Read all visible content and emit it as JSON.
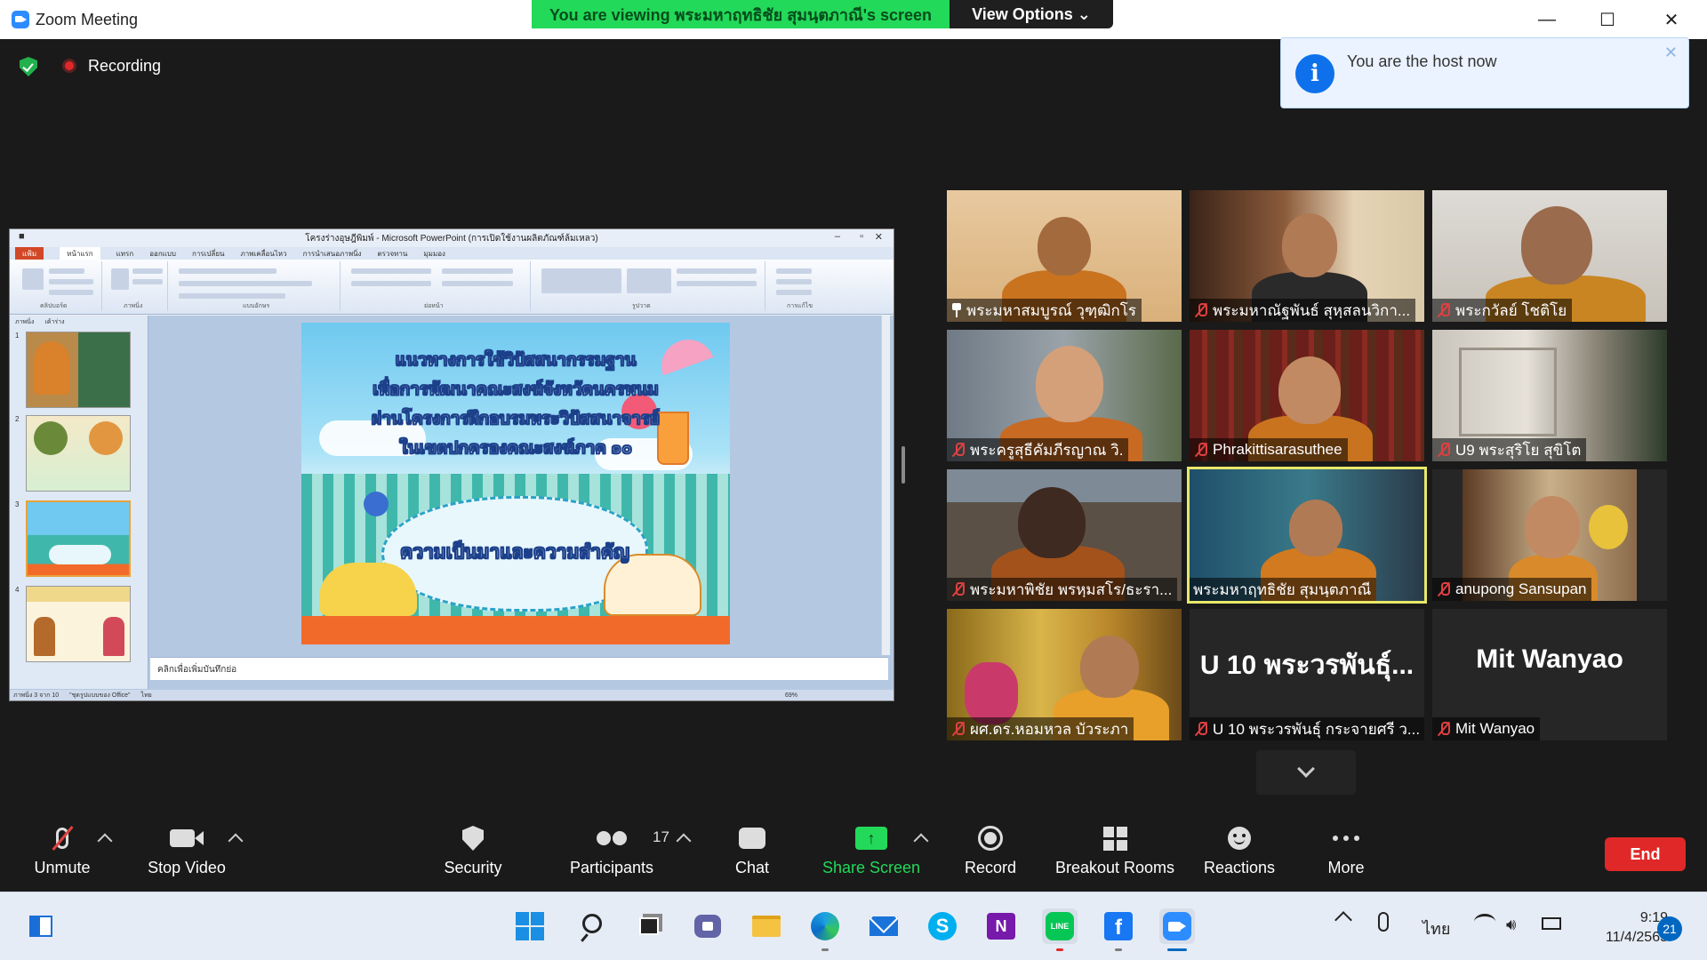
{
  "window": {
    "title": "Zoom Meeting",
    "minimize": "—",
    "maximize": "☐",
    "close": "✕"
  },
  "banner": {
    "viewing_text": "You are viewing พระมหาฤทธิชัย สุมนฺตภาณี's screen",
    "view_options": "View Options ⌄"
  },
  "status": {
    "recording": "Recording"
  },
  "toast": {
    "message": "You are the host now",
    "close": "✕"
  },
  "shared_screen": {
    "ppt_title": "โครงร่างอุษฎีพิมพ์ - Microsoft PowerPoint (การเปิดใช้งานผลิตภัณฑ์ล้มเหลว)",
    "ribbon_tabs": [
      "แฟ้ม",
      "หน้าแรก",
      "แทรก",
      "ออกแบบ",
      "การเปลี่ยน",
      "ภาพเคลื่อนไหว",
      "การนำเสนอภาพนิ่ง",
      "ตรวจทาน",
      "มุมมอง"
    ],
    "ribbon_groups": [
      "คลิปบอร์ด",
      "ภาพนิ่ง",
      "แบบอักษร",
      "ย่อหน้า",
      "รูปวาด",
      "การแก้ไข"
    ],
    "panel_tabs": [
      "ภาพนิ่ง",
      "เค้าร่าง"
    ],
    "slide_numbers": [
      "1",
      "2",
      "3",
      "4"
    ],
    "slide_title_lines": [
      "แนวทางการใช้วิปัสสนากรรมฐาน",
      "เพื่อการพัฒนาคณะสงฆ์จังหวัดนครพนม",
      "ผ่านโครงการฝึกอบรมพระวิปัสสนาจารย์",
      "ในเขตปกครองคณะสงฆ์ภาค ๑๐"
    ],
    "slide_subtitle": "ความเป็นมาและความสำคัญ",
    "notes_placeholder": "คลิกเพื่อเพิ่มบันทึกย่อ",
    "status_slide": "ภาพนิ่ง 3 จาก 10",
    "status_theme": "\"ชุดรูปแบบของ Office\"",
    "status_lang": "ไทย",
    "zoom": "69%"
  },
  "participants": [
    {
      "name": "พระมหาสมบูรณ์ วุฑฺฒิกโร",
      "indicator": "pin"
    },
    {
      "name": "พระมหาณัฐพันธ์ สุหฺสลนวิกา...",
      "indicator": "muted"
    },
    {
      "name": "พระกวัลย์ โชติโย",
      "indicator": "muted"
    },
    {
      "name": "พระครูสุธีคัมภีรญาณ วิ.",
      "indicator": "muted"
    },
    {
      "name": "Phrakittisarasuthee",
      "indicator": "muted"
    },
    {
      "name": "U9 พระสุริโย สุขิโต",
      "indicator": "muted"
    },
    {
      "name": "พระมหาพิชัย พรหฺมสโร/ธะรา...",
      "indicator": "muted"
    },
    {
      "name": "พระมหาฤทธิชัย สุมนฺตภาณี",
      "indicator": "none",
      "active_speaker": true
    },
    {
      "name": "anupong Sansupan",
      "indicator": "muted"
    },
    {
      "name": "ผศ.ดร.หอมหวล บัวระภา",
      "indicator": "muted"
    },
    {
      "name": "U 10 พระวรพันธุ์ กระจายศรี ว...",
      "indicator": "muted",
      "display_text": "U 10 พระวรพันธุ์..."
    },
    {
      "name": "Mit Wanyao",
      "indicator": "muted",
      "display_text": "Mit Wanyao"
    }
  ],
  "toolbar": {
    "unmute": "Unmute",
    "stop_video": "Stop Video",
    "security": "Security",
    "participants": "Participants",
    "participant_count": "17",
    "chat": "Chat",
    "share_screen": "Share Screen",
    "record": "Record",
    "breakout_rooms": "Breakout Rooms",
    "reactions": "Reactions",
    "more": "More",
    "end": "End"
  },
  "taskbar": {
    "language": "ไทย",
    "time": "9:19",
    "date": "11/4/2565",
    "notifications": "21",
    "line_label": "LINE",
    "onenote_label": "N",
    "facebook_label": "f",
    "skype_label": "S"
  },
  "colors": {
    "zoom_blue": "#2d8cff",
    "banner_green": "#23d959",
    "end_red": "#e02828",
    "active_speaker": "#e8e86a"
  }
}
